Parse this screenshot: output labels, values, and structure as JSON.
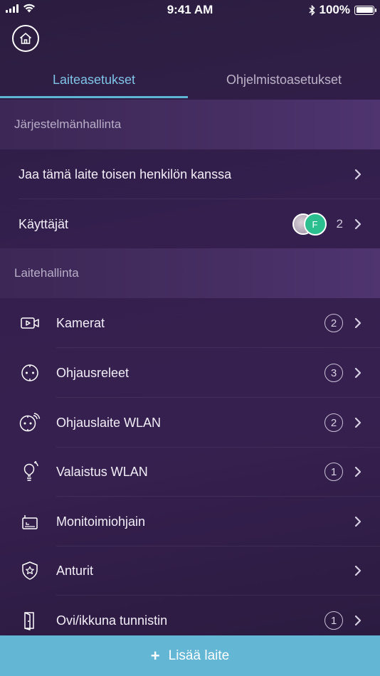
{
  "status_bar": {
    "time": "9:41 AM",
    "battery": "100%"
  },
  "home_button": {
    "icon": "home-icon"
  },
  "tabs": [
    {
      "label": "Laiteasetukset",
      "active": true
    },
    {
      "label": "Ohjelmistoasetukset",
      "active": false
    }
  ],
  "system_section": {
    "title": "Järjestelmänhallinta",
    "items": [
      {
        "label": "Jaa tämä laite toisen henkilön kanssa"
      },
      {
        "label": "Käyttäjät",
        "avatar_initial": "F",
        "count": "2"
      }
    ]
  },
  "device_section": {
    "title": "Laitehallinta",
    "items": [
      {
        "label": "Kamerat",
        "icon": "camera-icon",
        "count": "2"
      },
      {
        "label": "Ohjausreleet",
        "icon": "relay-socket-icon",
        "count": "3"
      },
      {
        "label": "Ohjauslaite WLAN",
        "icon": "wlan-socket-icon",
        "count": "2"
      },
      {
        "label": "Valaistus WLAN",
        "icon": "lightbulb-icon",
        "count": "1"
      },
      {
        "label": "Monitoimiohjain",
        "icon": "controller-icon",
        "count": ""
      },
      {
        "label": "Anturit",
        "icon": "sensor-shield-icon",
        "count": ""
      },
      {
        "label": "Ovi/ikkuna tunnistin",
        "icon": "door-sensor-icon",
        "count": "1"
      }
    ]
  },
  "add_button": {
    "label": "Lisää laite"
  },
  "colors": {
    "accent": "#63b6d4",
    "active_tab": "#7fc4e6",
    "avatar": "#2bbf8f"
  }
}
